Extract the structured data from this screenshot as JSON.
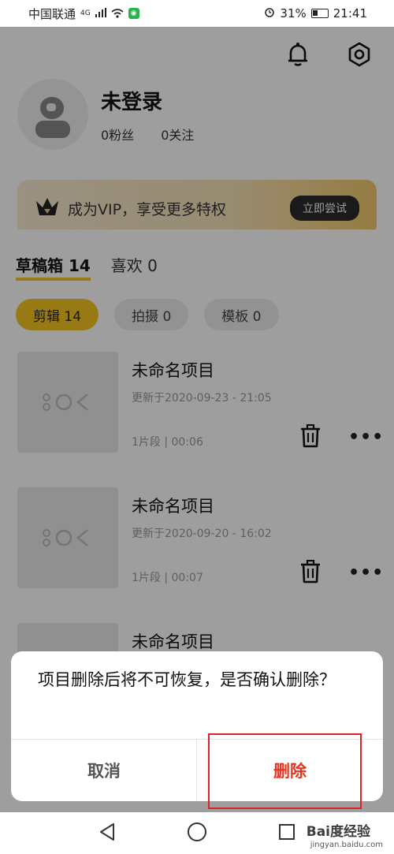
{
  "status_bar": {
    "carrier": "中国联通",
    "network": "4G",
    "battery": "31%",
    "time": "21:41"
  },
  "profile": {
    "username": "未登录",
    "fans": "0粉丝",
    "following": "0关注"
  },
  "vip": {
    "text": "成为VIP，享受更多特权",
    "button": "立即尝试"
  },
  "tabs": [
    {
      "label": "草稿箱 14",
      "active": true
    },
    {
      "label": "喜欢 0",
      "active": false
    }
  ],
  "chips": [
    {
      "label": "剪辑 14",
      "active": true
    },
    {
      "label": "拍摄 0",
      "active": false
    },
    {
      "label": "模板 0",
      "active": false
    }
  ],
  "projects": [
    {
      "title": "未命名项目",
      "updated": "更新于2020-09-23 - 21:05",
      "meta": "1片段 | 00:06"
    },
    {
      "title": "未命名项目",
      "updated": "更新于2020-09-20 - 16:02",
      "meta": "1片段 | 00:07"
    },
    {
      "title": "未命名项目"
    }
  ],
  "dialog": {
    "message": "项目删除后将不可恢复，是否确认删除？",
    "cancel": "取消",
    "delete": "删除"
  },
  "watermark": {
    "logo": "Bai度经验",
    "url": "jingyan.baidu.com"
  },
  "colors": {
    "accent": "#f5c623",
    "danger": "#e8341f",
    "highlight": "#d9222a"
  }
}
